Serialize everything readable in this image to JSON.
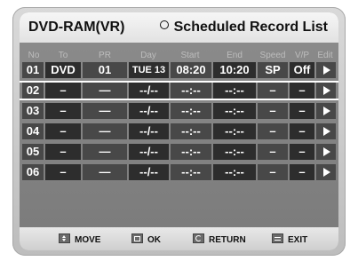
{
  "header": {
    "left_title": "DVD-RAM(VR)",
    "right_title": "Scheduled Record List"
  },
  "columns": [
    "No",
    "To",
    "PR",
    "Day",
    "Start",
    "End",
    "Speed",
    "V/P",
    "Edit"
  ],
  "rows": [
    {
      "no": "01",
      "to": "DVD",
      "pr": "01",
      "day": "TUE 13",
      "start": "08:20",
      "end": "10:20",
      "speed": "SP",
      "vp": "Off"
    },
    {
      "no": "02",
      "to": "–",
      "pr": "—",
      "day": "--/--",
      "start": "--:--",
      "end": "--:--",
      "speed": "–",
      "vp": "–"
    },
    {
      "no": "03",
      "to": "–",
      "pr": "—",
      "day": "--/--",
      "start": "--:--",
      "end": "--:--",
      "speed": "–",
      "vp": "–"
    },
    {
      "no": "04",
      "to": "–",
      "pr": "—",
      "day": "--/--",
      "start": "--:--",
      "end": "--:--",
      "speed": "–",
      "vp": "–"
    },
    {
      "no": "05",
      "to": "–",
      "pr": "—",
      "day": "--/--",
      "start": "--:--",
      "end": "--:--",
      "speed": "–",
      "vp": "–"
    },
    {
      "no": "06",
      "to": "–",
      "pr": "—",
      "day": "--/--",
      "start": "--:--",
      "end": "--:--",
      "speed": "–",
      "vp": "–"
    }
  ],
  "selected_row": "02",
  "footer": {
    "move": "MOVE",
    "ok": "OK",
    "return": "RETURN",
    "exit": "EXIT"
  },
  "icons": {
    "header": "circle-icon",
    "edit": "play-arrow-icon",
    "move": "updown-icon",
    "ok": "ok-icon",
    "return": "return-icon",
    "exit": "exit-icon"
  }
}
